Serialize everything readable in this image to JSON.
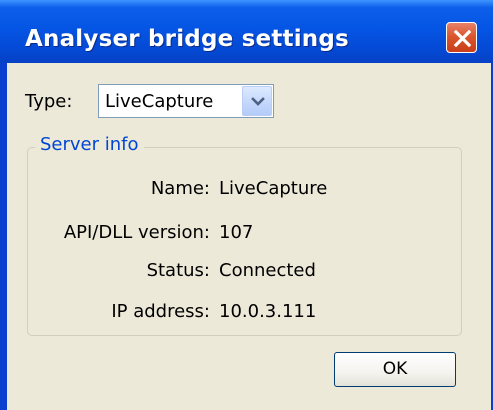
{
  "window": {
    "title": "Analyser bridge settings",
    "close_icon": "close-icon"
  },
  "type": {
    "label": "Type:",
    "selected": "LiveCapture",
    "dropdown_icon": "chevron-down-icon"
  },
  "server_info": {
    "group_label": "Server info",
    "rows": [
      {
        "label": "Name:",
        "value": "LiveCapture"
      },
      {
        "label": "API/DLL version:",
        "value": "107"
      },
      {
        "label": "Status:",
        "value": "Connected"
      },
      {
        "label": "IP address:",
        "value": "10.0.3.111"
      }
    ]
  },
  "buttons": {
    "ok_label": "OK"
  },
  "colors": {
    "titlebar": "#0555e4",
    "close_button": "#d9572f",
    "dialog_background": "#ece9d8",
    "group_label": "#0046d5"
  }
}
